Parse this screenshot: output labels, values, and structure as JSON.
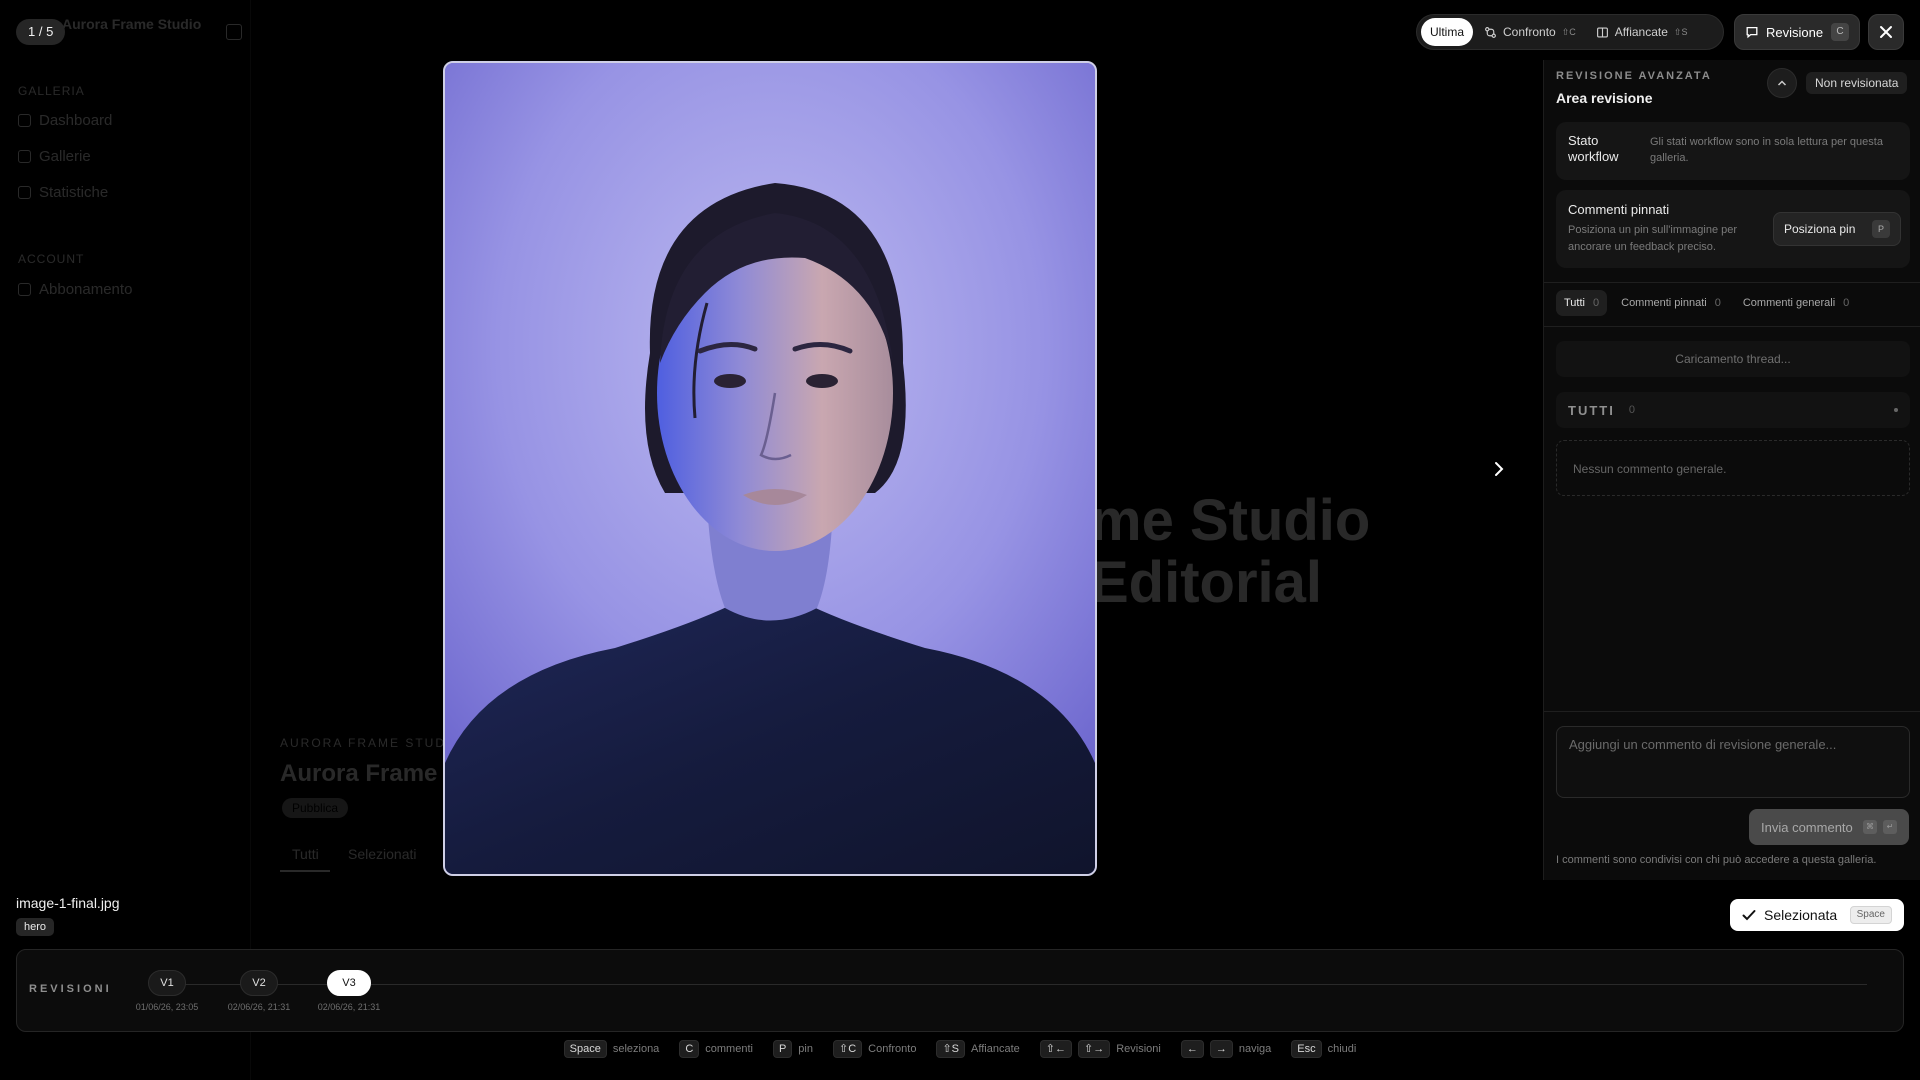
{
  "counter": "1 / 5",
  "background_app": {
    "brand": "Aurora Frame Studio",
    "sections": [
      {
        "label": "GALLERIA",
        "items": [
          "Dashboard",
          "Gallerie",
          "Statistiche"
        ]
      },
      {
        "label": "ACCOUNT",
        "items": [
          "Abbonamento"
        ]
      }
    ],
    "hero_line1": "me Studio",
    "hero_line2": "Editorial",
    "eyebrow": "AURORA FRAME STUDIO",
    "title": "Aurora Frame S",
    "chip": "Pubblica",
    "tabs": [
      "Tutti",
      "Selezionati"
    ]
  },
  "toolbar": {
    "modes": [
      {
        "label": "Ultima",
        "shortcut": "",
        "icon": "",
        "active": true
      },
      {
        "label": "Confronto",
        "shortcut": "⇧C",
        "icon": "compare-icon",
        "active": false
      },
      {
        "label": "Affiancate",
        "shortcut": "⇧S",
        "icon": "split-view-icon",
        "active": false
      }
    ],
    "review_label": "Revisione",
    "review_shortcut": "C",
    "close_icon": "close-icon"
  },
  "image": {
    "filename": "image-1-final.jpg",
    "tag": "hero",
    "next_icon": "chevron-right-icon"
  },
  "panel": {
    "eyebrow": "REVISIONE AVANZATA",
    "title": "Area revisione",
    "status": "Non revisionata",
    "workflow": {
      "label": "Stato workflow",
      "description": "Gli stati workflow sono in sola lettura per questa galleria."
    },
    "pins": {
      "label": "Commenti pinnati",
      "description": "Posiziona un pin sull'immagine per ancorare un feedback preciso.",
      "button": "Posiziona pin",
      "shortcut": "P"
    },
    "tabs": [
      {
        "label": "Tutti",
        "count": "0",
        "active": true
      },
      {
        "label": "Commenti pinnati",
        "count": "0",
        "active": false
      },
      {
        "label": "Commenti generali",
        "count": "0",
        "active": false
      }
    ],
    "loading": "Caricamento thread...",
    "section_title": "TUTTI",
    "section_count": "0",
    "empty": "Nessun commento generale.",
    "compose_placeholder": "Aggiungi un commento di revisione generale...",
    "send_label": "Invia commento",
    "send_keys": [
      "⌘",
      "↵"
    ],
    "share_note": "I commenti sono condivisi con chi può accedere a questa galleria."
  },
  "selected": {
    "label": "Selezionata",
    "shortcut": "Space"
  },
  "revisions": {
    "label": "REVISIONI",
    "items": [
      {
        "label": "V1",
        "date": "01/06/26, 23:05",
        "active": false
      },
      {
        "label": "V2",
        "date": "02/06/26, 21:31",
        "active": false
      },
      {
        "label": "V3",
        "date": "02/06/26, 21:31",
        "active": true
      }
    ]
  },
  "shortcuts": [
    {
      "keys": [
        "Space"
      ],
      "label": "seleziona"
    },
    {
      "keys": [
        "C"
      ],
      "label": "commenti"
    },
    {
      "keys": [
        "P"
      ],
      "label": "pin"
    },
    {
      "keys": [
        "⇧C"
      ],
      "label": "Confronto"
    },
    {
      "keys": [
        "⇧S"
      ],
      "label": "Affiancate"
    },
    {
      "keys": [
        "⇧←",
        "⇧→"
      ],
      "label": "Revisioni"
    },
    {
      "keys": [
        "←",
        "→"
      ],
      "label": "naviga"
    },
    {
      "keys": [
        "Esc"
      ],
      "label": "chiudi"
    }
  ]
}
